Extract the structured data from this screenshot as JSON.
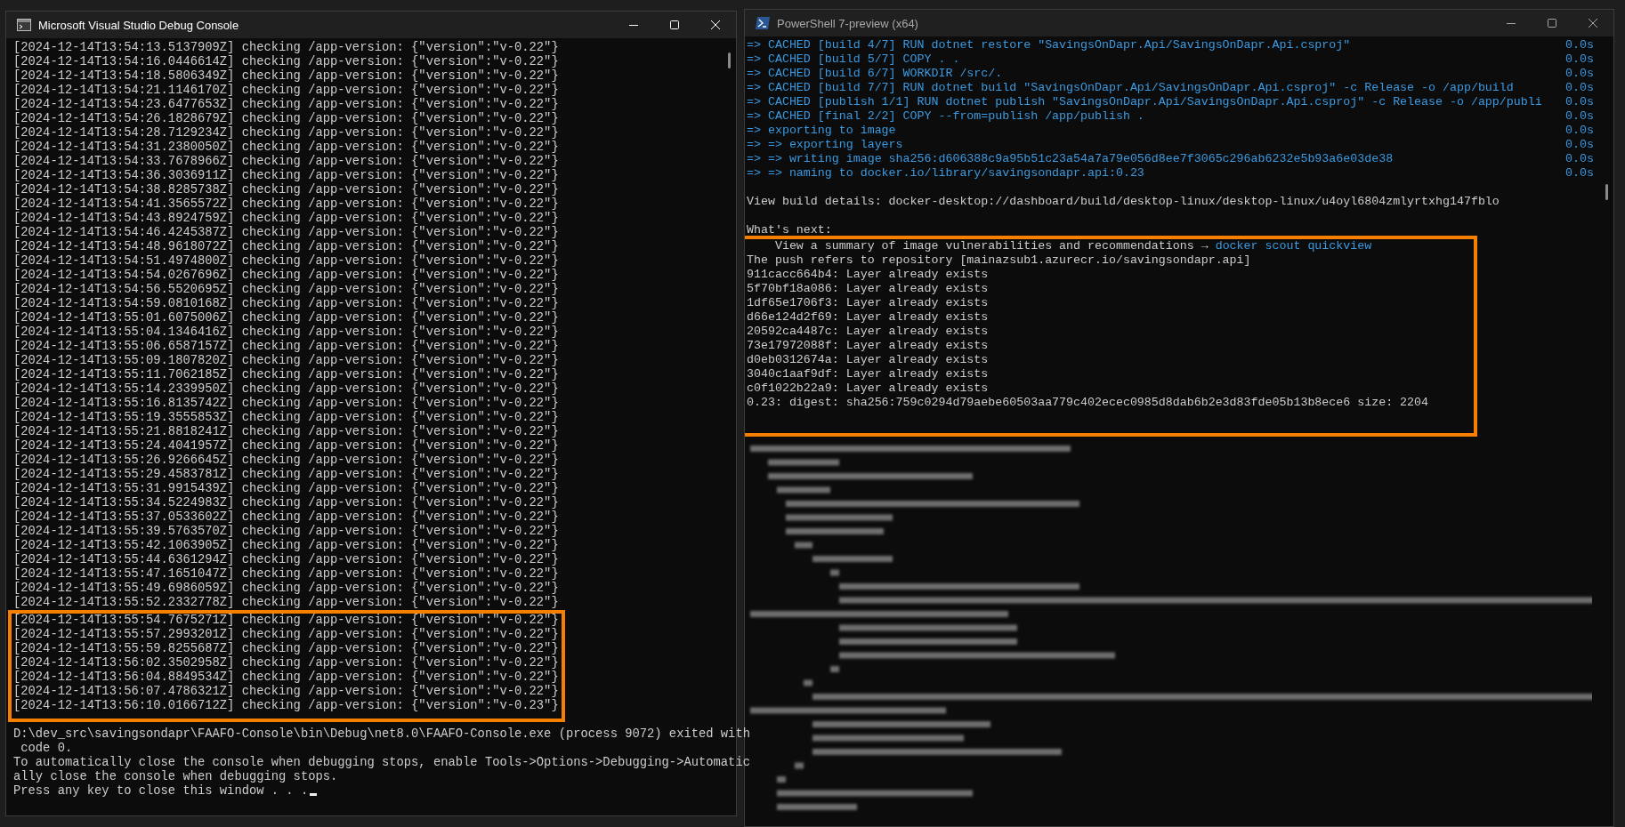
{
  "debug_console": {
    "title": "Microsoft Visual Studio Debug Console",
    "log_lines": [
      {
        "text": "[2024-12-14T13:54:13.5137909Z] checking /app-version: {\"version\":\"v-0.22\"}",
        "highlighted": false
      },
      {
        "text": "[2024-12-14T13:54:16.0446614Z] checking /app-version: {\"version\":\"v-0.22\"}",
        "highlighted": false
      },
      {
        "text": "[2024-12-14T13:54:18.5806349Z] checking /app-version: {\"version\":\"v-0.22\"}",
        "highlighted": false
      },
      {
        "text": "[2024-12-14T13:54:21.1146170Z] checking /app-version: {\"version\":\"v-0.22\"}",
        "highlighted": false
      },
      {
        "text": "[2024-12-14T13:54:23.6477653Z] checking /app-version: {\"version\":\"v-0.22\"}",
        "highlighted": false
      },
      {
        "text": "[2024-12-14T13:54:26.1828679Z] checking /app-version: {\"version\":\"v-0.22\"}",
        "highlighted": false
      },
      {
        "text": "[2024-12-14T13:54:28.7129234Z] checking /app-version: {\"version\":\"v-0.22\"}",
        "highlighted": false
      },
      {
        "text": "[2024-12-14T13:54:31.2380050Z] checking /app-version: {\"version\":\"v-0.22\"}",
        "highlighted": false
      },
      {
        "text": "[2024-12-14T13:54:33.7678966Z] checking /app-version: {\"version\":\"v-0.22\"}",
        "highlighted": false
      },
      {
        "text": "[2024-12-14T13:54:36.3036911Z] checking /app-version: {\"version\":\"v-0.22\"}",
        "highlighted": false
      },
      {
        "text": "[2024-12-14T13:54:38.8285738Z] checking /app-version: {\"version\":\"v-0.22\"}",
        "highlighted": false
      },
      {
        "text": "[2024-12-14T13:54:41.3565572Z] checking /app-version: {\"version\":\"v-0.22\"}",
        "highlighted": false
      },
      {
        "text": "[2024-12-14T13:54:43.8924759Z] checking /app-version: {\"version\":\"v-0.22\"}",
        "highlighted": false
      },
      {
        "text": "[2024-12-14T13:54:46.4245387Z] checking /app-version: {\"version\":\"v-0.22\"}",
        "highlighted": false
      },
      {
        "text": "[2024-12-14T13:54:48.9618072Z] checking /app-version: {\"version\":\"v-0.22\"}",
        "highlighted": false
      },
      {
        "text": "[2024-12-14T13:54:51.4974800Z] checking /app-version: {\"version\":\"v-0.22\"}",
        "highlighted": false
      },
      {
        "text": "[2024-12-14T13:54:54.0267696Z] checking /app-version: {\"version\":\"v-0.22\"}",
        "highlighted": false
      },
      {
        "text": "[2024-12-14T13:54:56.5520695Z] checking /app-version: {\"version\":\"v-0.22\"}",
        "highlighted": false
      },
      {
        "text": "[2024-12-14T13:54:59.0810168Z] checking /app-version: {\"version\":\"v-0.22\"}",
        "highlighted": false
      },
      {
        "text": "[2024-12-14T13:55:01.6075006Z] checking /app-version: {\"version\":\"v-0.22\"}",
        "highlighted": false
      },
      {
        "text": "[2024-12-14T13:55:04.1346416Z] checking /app-version: {\"version\":\"v-0.22\"}",
        "highlighted": false
      },
      {
        "text": "[2024-12-14T13:55:06.6587157Z] checking /app-version: {\"version\":\"v-0.22\"}",
        "highlighted": false
      },
      {
        "text": "[2024-12-14T13:55:09.1807820Z] checking /app-version: {\"version\":\"v-0.22\"}",
        "highlighted": false
      },
      {
        "text": "[2024-12-14T13:55:11.7062185Z] checking /app-version: {\"version\":\"v-0.22\"}",
        "highlighted": false
      },
      {
        "text": "[2024-12-14T13:55:14.2339950Z] checking /app-version: {\"version\":\"v-0.22\"}",
        "highlighted": false
      },
      {
        "text": "[2024-12-14T13:55:16.8135742Z] checking /app-version: {\"version\":\"v-0.22\"}",
        "highlighted": false
      },
      {
        "text": "[2024-12-14T13:55:19.3555853Z] checking /app-version: {\"version\":\"v-0.22\"}",
        "highlighted": false
      },
      {
        "text": "[2024-12-14T13:55:21.8818241Z] checking /app-version: {\"version\":\"v-0.22\"}",
        "highlighted": false
      },
      {
        "text": "[2024-12-14T13:55:24.4041957Z] checking /app-version: {\"version\":\"v-0.22\"}",
        "highlighted": false
      },
      {
        "text": "[2024-12-14T13:55:26.9266645Z] checking /app-version: {\"version\":\"v-0.22\"}",
        "highlighted": false
      },
      {
        "text": "[2024-12-14T13:55:29.4583781Z] checking /app-version: {\"version\":\"v-0.22\"}",
        "highlighted": false
      },
      {
        "text": "[2024-12-14T13:55:31.9915439Z] checking /app-version: {\"version\":\"v-0.22\"}",
        "highlighted": false
      },
      {
        "text": "[2024-12-14T13:55:34.5224983Z] checking /app-version: {\"version\":\"v-0.22\"}",
        "highlighted": false
      },
      {
        "text": "[2024-12-14T13:55:37.0533602Z] checking /app-version: {\"version\":\"v-0.22\"}",
        "highlighted": false
      },
      {
        "text": "[2024-12-14T13:55:39.5763570Z] checking /app-version: {\"version\":\"v-0.22\"}",
        "highlighted": false
      },
      {
        "text": "[2024-12-14T13:55:42.1063905Z] checking /app-version: {\"version\":\"v-0.22\"}",
        "highlighted": false
      },
      {
        "text": "[2024-12-14T13:55:44.6361294Z] checking /app-version: {\"version\":\"v-0.22\"}",
        "highlighted": false
      },
      {
        "text": "[2024-12-14T13:55:47.1651047Z] checking /app-version: {\"version\":\"v-0.22\"}",
        "highlighted": false
      },
      {
        "text": "[2024-12-14T13:55:49.6986059Z] checking /app-version: {\"version\":\"v-0.22\"}",
        "highlighted": false
      },
      {
        "text": "[2024-12-14T13:55:52.2332778Z] checking /app-version: {\"version\":\"v-0.22\"}",
        "highlighted": false
      },
      {
        "text": "[2024-12-14T13:55:54.7675271Z] checking /app-version: {\"version\":\"v-0.22\"}",
        "highlighted": true
      },
      {
        "text": "[2024-12-14T13:55:57.2993201Z] checking /app-version: {\"version\":\"v-0.22\"}",
        "highlighted": true
      },
      {
        "text": "[2024-12-14T13:55:59.8255687Z] checking /app-version: {\"version\":\"v-0.22\"}",
        "highlighted": true
      },
      {
        "text": "[2024-12-14T13:56:02.3502958Z] checking /app-version: {\"version\":\"v-0.22\"}",
        "highlighted": true
      },
      {
        "text": "[2024-12-14T13:56:04.8849534Z] checking /app-version: {\"version\":\"v-0.22\"}",
        "highlighted": true
      },
      {
        "text": "[2024-12-14T13:56:07.4786321Z] checking /app-version: {\"version\":\"v-0.22\"}",
        "highlighted": true
      },
      {
        "text": "[2024-12-14T13:56:10.0166712Z] checking /app-version: {\"version\":\"v-0.23\"}",
        "highlighted": true
      }
    ],
    "exit_lines": [
      "D:\\dev_src\\savingsondapr\\FAAFO-Console\\bin\\Debug\\net8.0\\FAAFO-Console.exe (process 9072) exited with",
      " code 0.",
      "To automatically close the console when debugging stops, enable Tools->Options->Debugging->Automatic",
      "ally close the console when debugging stops.",
      "Press any key to close this window . . ."
    ]
  },
  "powershell": {
    "title": "PowerShell 7-preview (x64)",
    "build_steps": [
      {
        "text": "=> CACHED [build 4/7] RUN dotnet restore \"SavingsOnDapr.Api/SavingsOnDapr.Api.csproj\"",
        "duration": "0.0s"
      },
      {
        "text": "=> CACHED [build 5/7] COPY . .",
        "duration": "0.0s"
      },
      {
        "text": "=> CACHED [build 6/7] WORKDIR /src/.",
        "duration": "0.0s"
      },
      {
        "text": "=> CACHED [build 7/7] RUN dotnet build \"SavingsOnDapr.Api/SavingsOnDapr.Api.csproj\" -c Release -o /app/build",
        "duration": "0.0s"
      },
      {
        "text": "=> CACHED [publish 1/1] RUN dotnet publish \"SavingsOnDapr.Api/SavingsOnDapr.Api.csproj\" -c Release -o /app/publi",
        "duration": "0.0s"
      },
      {
        "text": "=> CACHED [final 2/2] COPY --from=publish /app/publish .",
        "duration": "0.0s"
      },
      {
        "text": "=> exporting to image",
        "duration": "0.0s"
      },
      {
        "text": "=> => exporting layers",
        "duration": "0.0s"
      },
      {
        "text": "=> => writing image sha256:d606388c9a95b51c23a54a7a79e056d8ee7f3065c296ab6232e5b93a6e03de38",
        "duration": "0.0s"
      },
      {
        "text": "=> => naming to docker.io/library/savingsondapr.api:0.23",
        "duration": "0.0s"
      }
    ],
    "build_details": "View build details: docker-desktop://dashboard/build/desktop-linux/desktop-linux/u4oyl6804zmlyrtxhg147fblo",
    "next_heading": "What's next:",
    "highlight": {
      "summary": {
        "text": "    View a summary of image vulnerabilities and recommendations →",
        "link": "docker scout quickview"
      },
      "push_lines": [
        "The push refers to repository [mainazsub1.azurecr.io/savingsondapr.api]",
        "911cacc664b4: Layer already exists",
        "5f70bf18a086: Layer already exists",
        "1df65e1706f3: Layer already exists",
        "d66e124d2f69: Layer already exists",
        "20592ca4487c: Layer already exists",
        "73e17972088f: Layer already exists",
        "d0eb0312674a: Layer already exists",
        "3040c1aaf9df: Layer already exists",
        "c0f1022b22a9: Layer already exists",
        "0.23: digest: sha256:759c0294d79aebe60503aa779c402ecec0985d8dab6b2e3d83fde05b13b8ece6 size: 2204"
      ]
    }
  }
}
